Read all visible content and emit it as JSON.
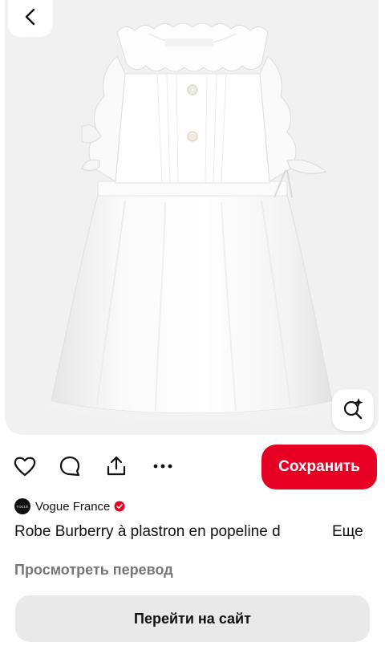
{
  "pin": {
    "image_description_icon": "white-dress-photo"
  },
  "top_bar": {
    "back_icon": "chevron-left-icon"
  },
  "image_overlay": {
    "visual_search_icon": "visual-search-icon"
  },
  "actions": {
    "like_icon": "heart-icon",
    "comment_icon": "comment-icon",
    "share_icon": "share-icon",
    "more_icon": "more-dots-icon",
    "save_label": "Сохранить",
    "save_color": "#e60023"
  },
  "source": {
    "avatar_text": "VOGUE",
    "name": "Vogue France",
    "verified_color": "#e60023"
  },
  "title": {
    "text": "Robe Burberry à plastron en popeline d",
    "more_label": "Еще"
  },
  "translate_label": "Просмотреть перевод",
  "visit_label": "Перейти на сайт"
}
